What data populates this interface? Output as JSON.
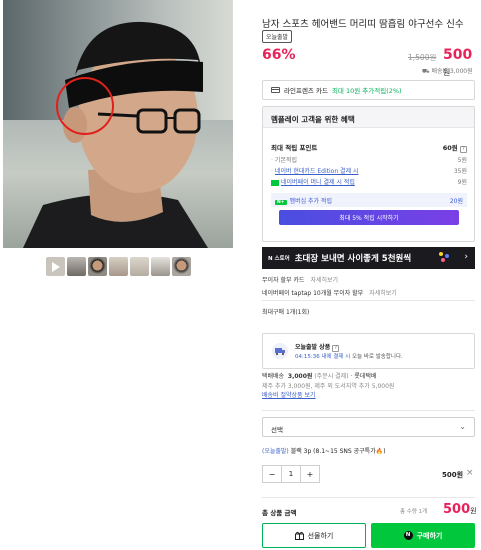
{
  "product": {
    "title": "남자 스포츠 헤어밴드 머리띠 땀흡림 야구선수 신수",
    "badge": "오늘출발",
    "discount": "66%",
    "original_price": "1,500원",
    "price": "500",
    "price_unit": "원",
    "shipping_fee": "배송비 3,000원"
  },
  "card_benefit": {
    "text": "라인프렌즈 카드",
    "highlight": "최대 10원 추가적립(2%)"
  },
  "benefits": {
    "header": "멤플레이 고객을 위한 혜택",
    "max_points_label": "최대 적립 포인트",
    "max_points_value": "60원",
    "rows": [
      {
        "label": "기본적립",
        "value": "5원"
      },
      {
        "label": "네이버 현대카드 Edition 결제 시",
        "value": "35원"
      },
      {
        "label": "네이버페이 머니 결제 시 적립",
        "value": "9원"
      }
    ],
    "membership_label": "멤버십 추가 적립",
    "membership_value": "20원",
    "membership_tag": "N+",
    "membership_button": "최대 5% 적립 시작하기"
  },
  "banner": {
    "logo": "N 스토어",
    "text": "초대장 보내면 사이좋게 5천원씩",
    "chevron": "›"
  },
  "info_rows": [
    {
      "label": "무이자 할부 카드",
      "more": "자세히보기"
    },
    {
      "label": "네이버페이 taptap 10개월 무이자 할부",
      "more": "자세히보기"
    },
    {
      "label": "최대구매 1개(1회)",
      "more": ""
    }
  ],
  "today_ship": {
    "title": "오늘출발 상품",
    "time": "04:15:36 내에 결제 시",
    "desc": "오늘 바로 발송합니다."
  },
  "delivery": {
    "label": "택배배송",
    "fee": "3,000원",
    "method": "(주문시 결제)",
    "carrier": "롯데택배",
    "extra": "제주 추가 3,000원, 제주 외 도서지역 추가 5,000원",
    "link": "배송비 절약상품 보기"
  },
  "option_select": {
    "placeholder": "선택",
    "arrow": "⌄"
  },
  "selected_option": {
    "prefix": "(오늘출발)",
    "name": "블랙 3p (8.1~15 SNS 공구특가",
    "suffix": ")"
  },
  "quantity": {
    "minus": "−",
    "value": "1",
    "plus": "+",
    "row_price": "500원",
    "remove": "×"
  },
  "total": {
    "label": "총 상품 금액",
    "count": "총 수량 1개",
    "price": "500",
    "unit": "원"
  },
  "actions": {
    "gift": "선물하기",
    "buy": "구매하기",
    "buy_badge": "N"
  },
  "colors": {
    "sale": "#e8235b",
    "naver_green": "#00c73c",
    "link_blue": "#3a5fc9",
    "banner_bg": "#1b1b1f"
  }
}
